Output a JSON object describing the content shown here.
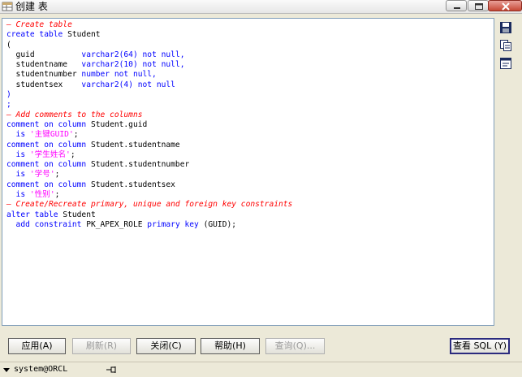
{
  "window": {
    "title": "创建 表"
  },
  "code_lines": [
    [
      {
        "t": "— Create table",
        "c": "cm"
      }
    ],
    [
      {
        "t": "create table ",
        "c": "kw"
      },
      {
        "t": "Student"
      }
    ],
    [
      {
        "t": "("
      }
    ],
    [
      {
        "t": "  guid          "
      },
      {
        "t": "varchar2(",
        "c": "kw"
      },
      {
        "t": "64",
        "c": "num"
      },
      {
        "t": ") not null,",
        "c": "kw"
      }
    ],
    [
      {
        "t": "  studentname   "
      },
      {
        "t": "varchar2(",
        "c": "kw"
      },
      {
        "t": "10",
        "c": "num"
      },
      {
        "t": ") not null,",
        "c": "kw"
      }
    ],
    [
      {
        "t": "  studentnumber "
      },
      {
        "t": "number not null,",
        "c": "kw"
      }
    ],
    [
      {
        "t": "  studentsex    "
      },
      {
        "t": "varchar2(",
        "c": "kw"
      },
      {
        "t": "4",
        "c": "num"
      },
      {
        "t": ") not null",
        "c": "kw"
      }
    ],
    [
      {
        "t": ")",
        "c": "kw"
      }
    ],
    [
      {
        "t": ";",
        "c": "kw"
      }
    ],
    [
      {
        "t": "— Add comments to the columns",
        "c": "cm"
      }
    ],
    [
      {
        "t": "comment on column ",
        "c": "kw"
      },
      {
        "t": "Student.guid"
      }
    ],
    [
      {
        "t": "  is ",
        "c": "kw"
      },
      {
        "t": "'主键GUID'",
        "c": "str"
      },
      {
        "t": ";"
      }
    ],
    [
      {
        "t": "comment on column ",
        "c": "kw"
      },
      {
        "t": "Student.studentname"
      }
    ],
    [
      {
        "t": "  is ",
        "c": "kw"
      },
      {
        "t": "'学生姓名'",
        "c": "str"
      },
      {
        "t": ";"
      }
    ],
    [
      {
        "t": "comment on column ",
        "c": "kw"
      },
      {
        "t": "Student.studentnumber"
      }
    ],
    [
      {
        "t": "  is ",
        "c": "kw"
      },
      {
        "t": "'学号'",
        "c": "str"
      },
      {
        "t": ";"
      }
    ],
    [
      {
        "t": "comment on column ",
        "c": "kw"
      },
      {
        "t": "Student.studentsex"
      }
    ],
    [
      {
        "t": "  is ",
        "c": "kw"
      },
      {
        "t": "'性别'",
        "c": "str"
      },
      {
        "t": ";"
      }
    ],
    [
      {
        "t": "— Create/Recreate primary, unique and foreign key constraints",
        "c": "cm"
      }
    ],
    [
      {
        "t": "alter table ",
        "c": "kw"
      },
      {
        "t": "Student"
      }
    ],
    [
      {
        "t": "  add constraint ",
        "c": "kw"
      },
      {
        "t": "PK_APEX_ROLE "
      },
      {
        "t": "primary key ",
        "c": "kw"
      },
      {
        "t": "(GUID);"
      }
    ]
  ],
  "side_tools": [
    {
      "icon": "save-icon"
    },
    {
      "icon": "copy-icon"
    },
    {
      "icon": "format-icon"
    }
  ],
  "buttons": {
    "apply": "应用(A)",
    "refresh": "刷新(R)",
    "close": "关闭(C)",
    "help": "帮助(H)",
    "query": "查询(Q)...",
    "view_sql": "查看 SQL (Y)"
  },
  "status": {
    "connection": "system@ORCL"
  }
}
